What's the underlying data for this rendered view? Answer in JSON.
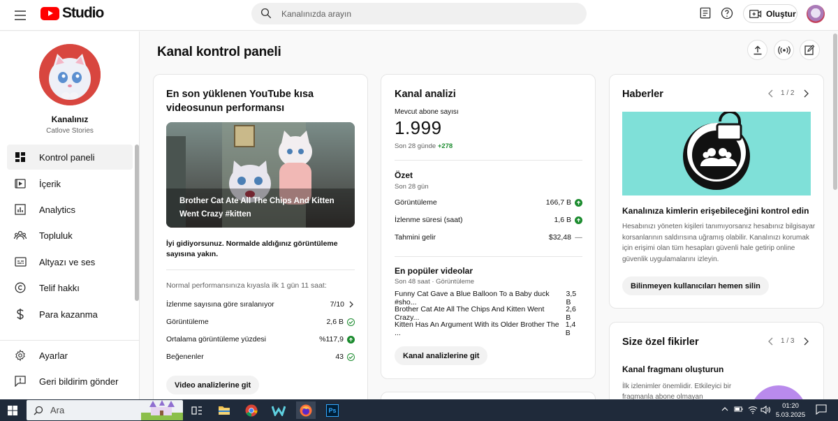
{
  "header": {
    "logo_text": "Studio",
    "search_placeholder": "Kanalınızda arayın",
    "create_label": "Oluştur"
  },
  "sidebar": {
    "channel_name": "Kanalınız",
    "channel_sub": "Catlove Stories",
    "items": [
      {
        "label": "Kontrol paneli",
        "icon": "dashboard-icon"
      },
      {
        "label": "İçerik",
        "icon": "content-icon"
      },
      {
        "label": "Analytics",
        "icon": "analytics-icon"
      },
      {
        "label": "Topluluk",
        "icon": "community-icon"
      },
      {
        "label": "Altyazı ve ses",
        "icon": "subtitles-icon"
      },
      {
        "label": "Telif hakkı",
        "icon": "copyright-icon"
      },
      {
        "label": "Para kazanma",
        "icon": "dollar-icon"
      }
    ],
    "bottom_items": [
      {
        "label": "Ayarlar",
        "icon": "gear-icon"
      },
      {
        "label": "Geri bildirim gönder",
        "icon": "feedback-icon"
      }
    ]
  },
  "main": {
    "title": "Kanal kontrol paneli"
  },
  "shorts_card": {
    "title": "En son yüklenen YouTube kısa videosunun performansı",
    "video_title": "Brother Cat Ate All The Chips And Kitten Went Crazy #kitten",
    "summary": "İyi gidiyorsunuz. Normalde aldığınız görüntüleme sayısına yakın.",
    "compare_note": "Normal performansınıza kıyasla ilk 1 gün 11 saat:",
    "rows": [
      {
        "label": "İzlenme sayısına göre sıralanıyor",
        "value": "7/10"
      },
      {
        "label": "Görüntüleme",
        "value": "2,6 B"
      },
      {
        "label": "Ortalama görüntüleme yüzdesi",
        "value": "%117,9"
      },
      {
        "label": "Beğenenler",
        "value": "43"
      }
    ],
    "button": "Video analizlerine git"
  },
  "analytics_card": {
    "title": "Kanal analizi",
    "subs_label": "Mevcut abone sayısı",
    "subs_value": "1.999",
    "subs_change_prefix": "Son 28 günde",
    "subs_change": "+278",
    "summary_title": "Özet",
    "summary_sub": "Son 28 gün",
    "summary_rows": [
      {
        "label": "Görüntüleme",
        "value": "166,7 B"
      },
      {
        "label": "İzlenme süresi (saat)",
        "value": "1,6 B"
      },
      {
        "label": "Tahmini gelir",
        "value": "$32,48",
        "trend": "—"
      }
    ],
    "popular_title": "En popüler videolar",
    "popular_sub": "Son 48 saat · Görüntüleme",
    "popular_rows": [
      {
        "label": "Funny Cat Gave a Blue Balloon To a Baby duck #sho...",
        "value": "3,5 B"
      },
      {
        "label": "Brother Cat Ate All The Chips And Kitten Went Crazy...",
        "value": "2,6 B"
      },
      {
        "label": "Kitten Has An Argument With its Older Brother The ...",
        "value": "1,4 B"
      }
    ],
    "button": "Kanal analizlerine git"
  },
  "news_card": {
    "title": "Haberler",
    "pager": "1 / 2",
    "headline": "Kanalınıza kimlerin erişebileceğini kontrol edin",
    "body": "Hesabınızı yöneten kişileri tanımıyorsanız hesabınız bilgisayar korsanlarının saldırısına uğramış olabilir. Kanalınızı korumak için erişimi olan tüm hesapları güvenli hale getirip online güvenlik uygulamalarını izleyin.",
    "button": "Bilinmeyen kullanıcıları hemen silin",
    "banner_color": "#7fe0d8"
  },
  "ideas_card": {
    "title": "Size özel fikirler",
    "pager": "1 / 3",
    "headline": "Kanal fragmanı oluşturun",
    "body": "İlk izlenimler önemlidir. Etkileyici bir fragmanla abone olmayan"
  },
  "taskbar": {
    "search_label": "Ara",
    "time": "01:20",
    "date": "5.03.2025"
  }
}
